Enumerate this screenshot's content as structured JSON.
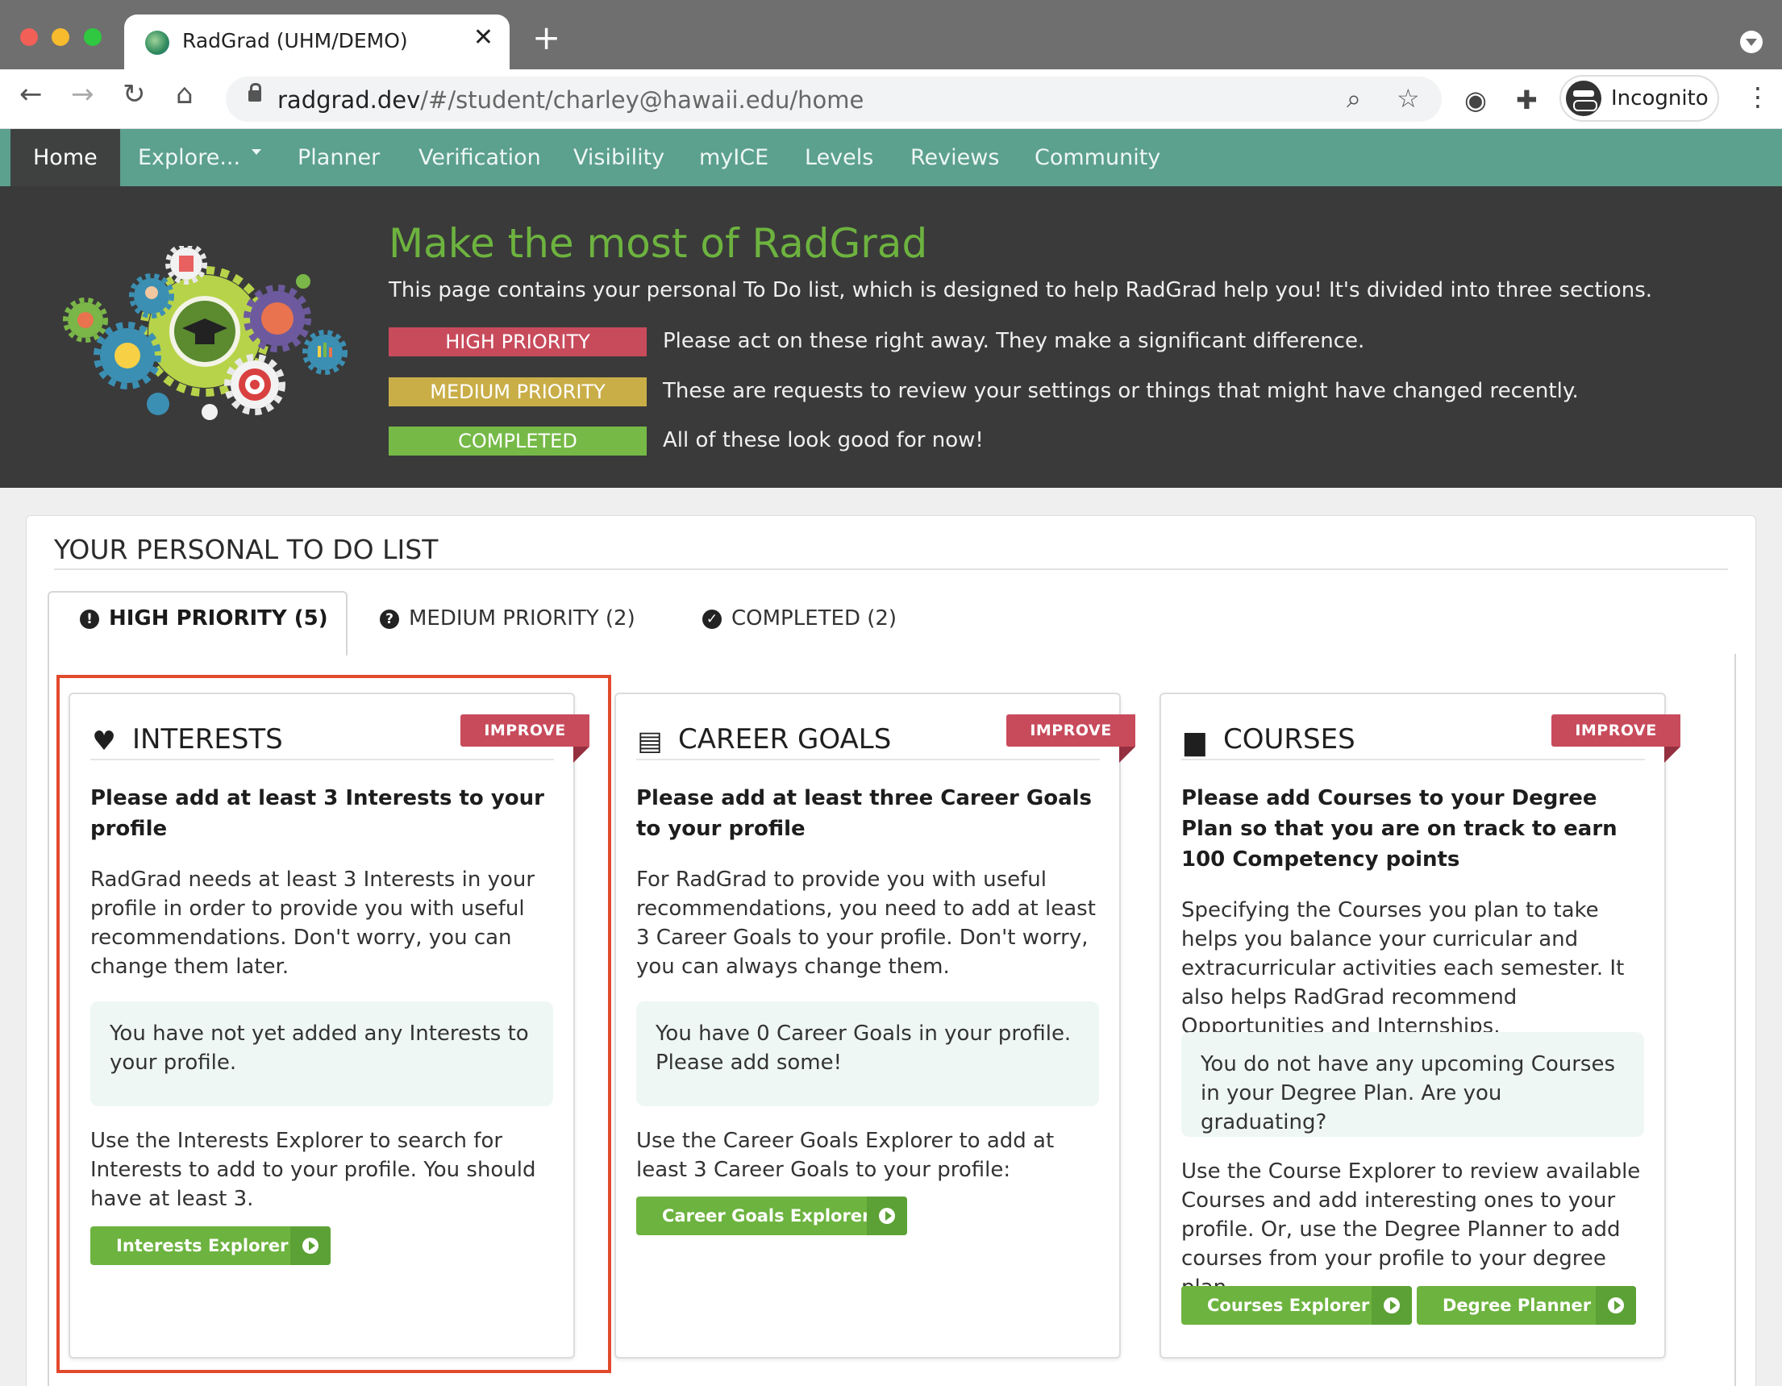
{
  "browser": {
    "tab_title": "RadGrad (UHM/DEMO)",
    "url_host": "radgrad.dev",
    "url_path": "/#/student/charley@hawaii.edu/home",
    "profile_label": "Incognito"
  },
  "nav": {
    "items": [
      "Home",
      "Explore...",
      "Planner",
      "Verification",
      "Visibility",
      "myICE",
      "Levels",
      "Reviews",
      "Community"
    ],
    "active": "Home"
  },
  "banner": {
    "title": "Make the most of RadGrad",
    "text": "This page contains your personal To Do list, which is designed to help RadGrad help you! It's divided into three sections.",
    "legend": [
      {
        "label": "HIGH PRIORITY",
        "desc": "Please act on these right away. They make a significant difference.",
        "color": "#c84b5c"
      },
      {
        "label": "MEDIUM PRIORITY",
        "desc": "These are requests to review your settings or things that might have changed recently.",
        "color": "#c9ae48"
      },
      {
        "label": "COMPLETED",
        "desc": "All of these look good for now!",
        "color": "#76b947"
      }
    ]
  },
  "todo": {
    "section_title": "YOUR PERSONAL TO DO LIST",
    "tabs": [
      "HIGH PRIORITY (5)",
      "MEDIUM PRIORITY (2)",
      "COMPLETED (2)"
    ],
    "active_tab": "HIGH PRIORITY (5)",
    "cards": [
      {
        "icon": "heart-icon",
        "heading": "INTERESTS",
        "badge": "IMPROVE",
        "title": "Please add at least 3 Interests to your profile",
        "body": "RadGrad needs at least 3 Interests in your profile in order to provide you with useful recommendations. Don't worry, you can change them later.",
        "note": "You have not yet added any Interests to your profile.",
        "action_text": "Use the Interests Explorer to search for Interests to add to your profile. You should have at least 3.",
        "buttons": [
          "Interests Explorer"
        ]
      },
      {
        "icon": "briefcase-icon",
        "heading": "CAREER GOALS",
        "badge": "IMPROVE",
        "title": "Please add at least three Career Goals to your profile",
        "body": "For RadGrad to provide you with useful recommendations, you need to add at least 3 Career Goals to your profile. Don't worry, you can always change them.",
        "note": "You have 0 Career Goals in your profile. Please add some!",
        "action_text": "Use the Career Goals Explorer to add at least 3 Career Goals to your profile:",
        "buttons": [
          "Career Goals Explorer"
        ]
      },
      {
        "icon": "book-icon",
        "heading": "COURSES",
        "badge": "IMPROVE",
        "title": "Please add Courses to your Degree Plan so that you are on track to earn 100 Competency points",
        "body": "Specifying the Courses you plan to take helps you balance your curricular and extracurricular activities each semester. It also helps RadGrad recommend Opportunities and Internships.",
        "note": "You do not have any upcoming Courses in your Degree Plan. Are you graduating?",
        "action_text": "Use the Course Explorer to review available Courses and add interesting ones to your profile. Or, use the Degree Planner to add courses from your profile to your degree plan.",
        "buttons": [
          "Courses Explorer",
          "Degree Planner"
        ]
      }
    ]
  },
  "colors": {
    "nav_green": "#5ca08e",
    "banner_bg": "#3a3a3a",
    "title_green": "#6db33f",
    "button_green": "#6db33f",
    "improve_red": "#c84b5c",
    "highlight": "#e24a2c"
  }
}
